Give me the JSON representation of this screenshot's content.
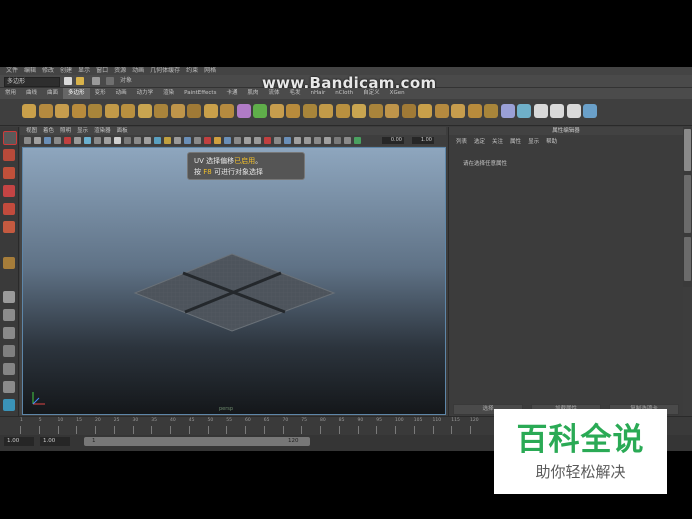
{
  "watermark": "www.Bandicam.com",
  "menubar": {
    "items": [
      "文件",
      "编辑",
      "修改",
      "创建",
      "显示",
      "窗口",
      "资源",
      "动画",
      "几何体缓存",
      "约束",
      "网格"
    ]
  },
  "status": {
    "mode": "多边形",
    "object_label": "对象"
  },
  "shelf": {
    "tabs": [
      {
        "label": "常用"
      },
      {
        "label": "曲线"
      },
      {
        "label": "曲面"
      },
      {
        "label": "多边形",
        "active": true
      },
      {
        "label": "变形"
      },
      {
        "label": "动画"
      },
      {
        "label": "动力学"
      },
      {
        "label": "渲染"
      },
      {
        "label": "PaintEffects"
      },
      {
        "label": "卡通"
      },
      {
        "label": "肌肉"
      },
      {
        "label": "流体"
      },
      {
        "label": "毛发"
      },
      {
        "label": "nHair"
      },
      {
        "label": "nCloth"
      },
      {
        "label": "自定义"
      },
      {
        "label": "XGen"
      }
    ]
  },
  "viewport_panel": {
    "menu": [
      "视图",
      "着色",
      "照明",
      "显示",
      "渲染器",
      "面板"
    ],
    "field_a": "0.00",
    "field_b": "1.00",
    "tooltip": {
      "line1_a": "UV 选择偏移",
      "line1_hl": "已启用",
      "line1_b": "。",
      "line2_a": "按 ",
      "line2_hl": "F8",
      "line2_b": " 可进行对象选择"
    },
    "camera_label": "persp"
  },
  "attribute_editor": {
    "title": "属性编辑器",
    "menu": [
      "列表",
      "选定",
      "关注",
      "属性",
      "显示",
      "帮助"
    ],
    "message": "请在选择任意属性",
    "buttons": [
      "选择",
      "加载属性",
      "复制选项卡"
    ]
  },
  "timeline": {
    "ticks": [
      "1",
      "5",
      "10",
      "15",
      "20",
      "25",
      "30",
      "35",
      "40",
      "45",
      "50",
      "55",
      "60",
      "65",
      "70",
      "75",
      "80",
      "85",
      "90",
      "95",
      "100",
      "105",
      "110",
      "115",
      "120"
    ]
  },
  "range": {
    "start": "1.00",
    "current": "1.00",
    "slider_start": "1",
    "slider_end": "120"
  },
  "overlay_logo": {
    "title": "百科全说",
    "subtitle": "助你轻松解决"
  }
}
